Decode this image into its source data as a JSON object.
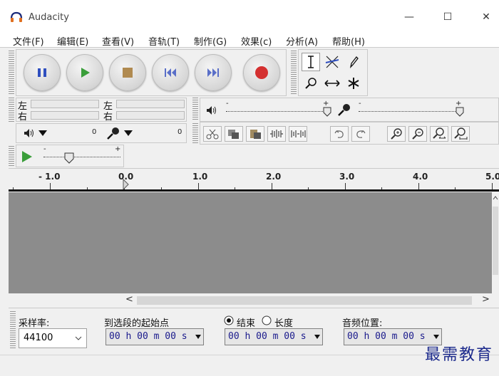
{
  "window": {
    "title": "Audacity",
    "minimize": "—",
    "maximize": "☐",
    "close": "✕"
  },
  "menu": [
    {
      "label": "文件(F)"
    },
    {
      "label": "编辑(E)"
    },
    {
      "label": "查看(V)"
    },
    {
      "label": "音轨(T)"
    },
    {
      "label": "制作(G)"
    },
    {
      "label": "效果(c)"
    },
    {
      "label": "分析(A)"
    },
    {
      "label": "帮助(H)"
    }
  ],
  "transport": {
    "pause": "pause-icon",
    "play": "play-icon",
    "stop": "stop-icon",
    "skip_start": "skip-start-icon",
    "skip_end": "skip-end-icon",
    "record": "record-icon"
  },
  "tools": [
    "selection-tool",
    "envelope-tool",
    "draw-tool",
    "zoom-tool",
    "timeshift-tool",
    "multi-tool"
  ],
  "meters": {
    "playback_left": "左",
    "playback_right": "右",
    "record_left": "左",
    "record_right": "右",
    "playback_value": "0",
    "record_value": "0"
  },
  "mixer": {
    "output_icon": "speaker-icon",
    "input_icon": "microphone-icon",
    "minus": "-",
    "plus": "+"
  },
  "play_at_speed": {
    "minus": "-",
    "plus": "+"
  },
  "ruler": {
    "labels": [
      "- 1.0",
      "0.0",
      "1.0",
      "2.0",
      "3.0",
      "4.0",
      "5.0"
    ]
  },
  "scroll": {
    "left": "<",
    "right": ">",
    "up": "^"
  },
  "selection": {
    "rate_label": "采样率:",
    "rate_value": "44100",
    "start_label": "到选段的起始点",
    "end_label": "结束",
    "length_label": "长度",
    "position_label": "音频位置:",
    "start_time": "00 h 00 m 00 s",
    "end_time": "00 h 00 m 00 s",
    "position_time": "00 h 00 m 00 s"
  },
  "watermark": "最需教育",
  "colors": {
    "track_bg": "#8c8c8c",
    "play_green": "#3a9e3a",
    "record_red": "#d43030",
    "pause_blue": "#2f4fbf"
  }
}
